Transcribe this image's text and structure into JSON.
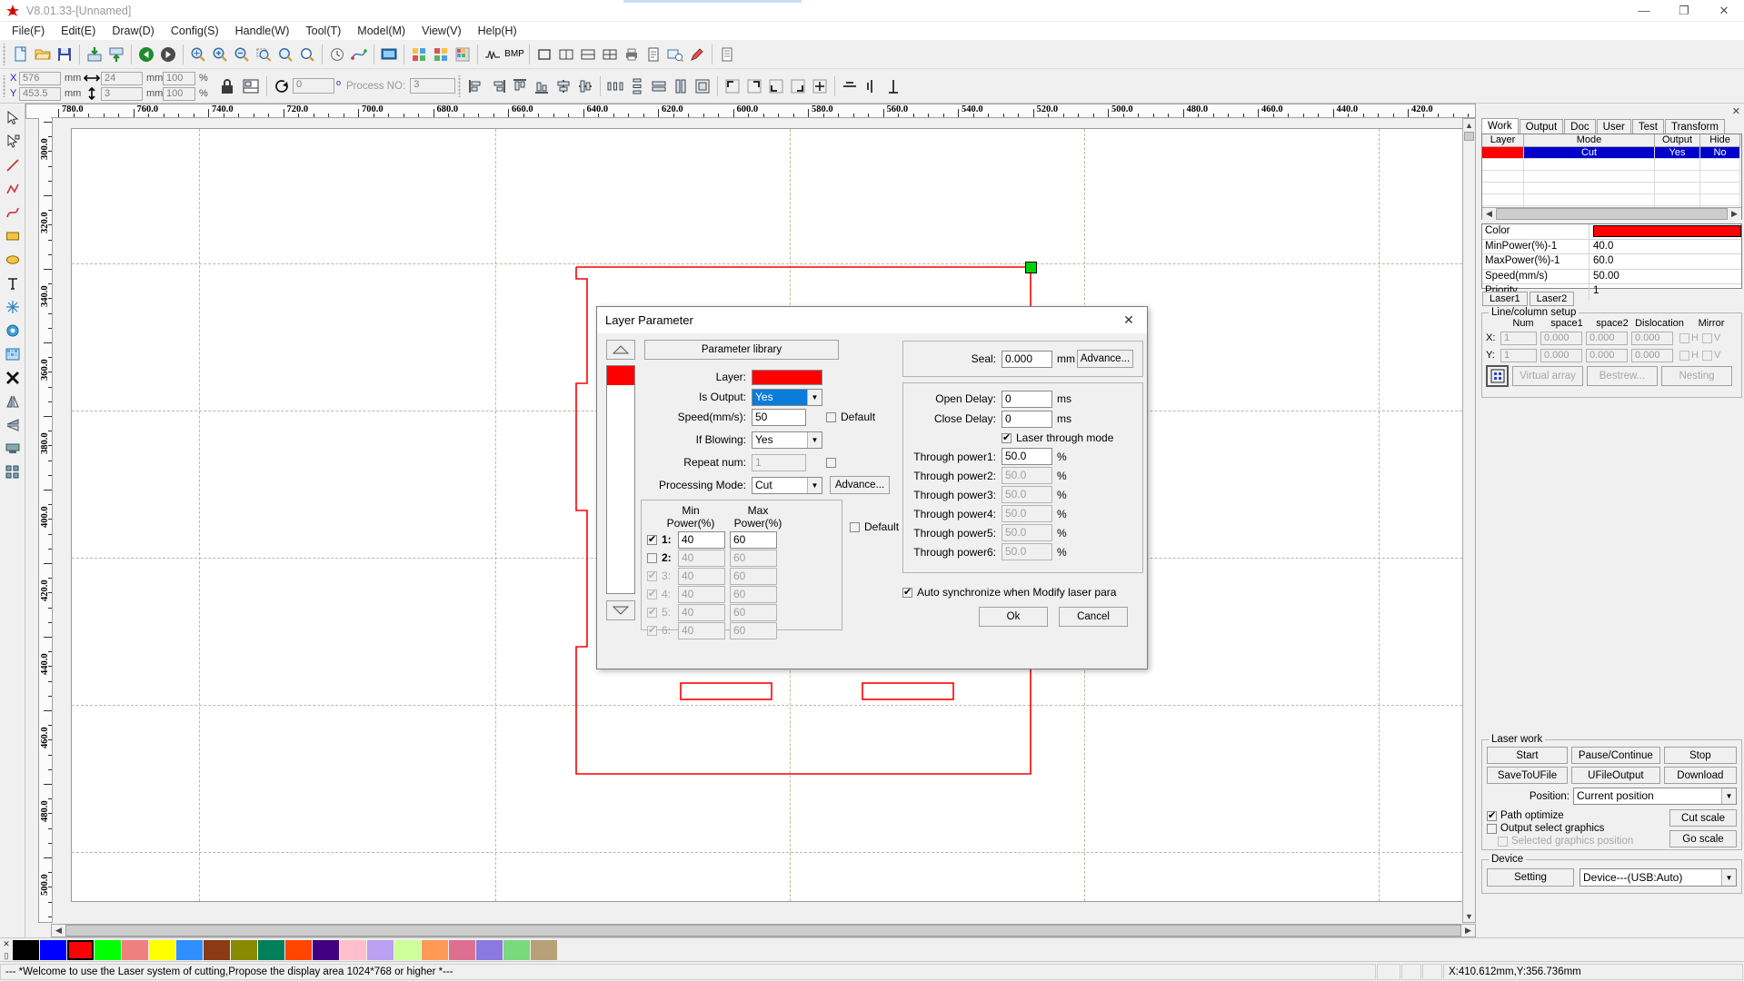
{
  "titlebar": {
    "title": "V8.01.33-[Unnamed]",
    "minimize": "—",
    "maximize": "❐",
    "close": "✕"
  },
  "menubar": {
    "items": [
      "File(F)",
      "Edit(E)",
      "Draw(D)",
      "Config(S)",
      "Handle(W)",
      "Tool(T)",
      "Model(M)",
      "View(V)",
      "Help(H)"
    ]
  },
  "toolbar2": {
    "x_label": "X",
    "x_value": "576",
    "x_unit": "mm",
    "y_label": "Y",
    "y_value": "453.5",
    "y_unit": "mm",
    "w_value": "24",
    "w_unit": "mm",
    "h_value": "3",
    "h_unit": "mm",
    "scale_x": "100",
    "scale_y": "100",
    "percent": "%",
    "angle_value": "0",
    "angle_unit": "o",
    "process_no_label": "Process NO:",
    "process_no_value": "3"
  },
  "rulers": {
    "horizontal": [
      "780.0",
      "760.0",
      "740.0",
      "720.0",
      "700.0",
      "680.0",
      "660.0",
      "640.0",
      "620.0",
      "600.0",
      "580.0",
      "560.0",
      "540.0",
      "520.0",
      "500.0",
      "480.0",
      "460.0",
      "440.0",
      "420.0"
    ],
    "vertical": [
      "300.0",
      "320.0",
      "340.0",
      "360.0",
      "380.0",
      "400.0",
      "420.0",
      "440.0",
      "460.0",
      "480.0",
      "500.0"
    ]
  },
  "right_panel": {
    "close": "✕",
    "tabs": [
      {
        "label": "Work",
        "active": true
      },
      {
        "label": "Output",
        "active": false
      },
      {
        "label": "Doc",
        "active": false
      },
      {
        "label": "User",
        "active": false
      },
      {
        "label": "Test",
        "active": false
      },
      {
        "label": "Transform",
        "active": false
      }
    ],
    "layer_table": {
      "headers": [
        "Layer",
        "Mode",
        "Output",
        "Hide"
      ],
      "rows": [
        {
          "layer_color": "#ff0000",
          "mode": "Cut",
          "output": "Yes",
          "hide": "No",
          "selected": true
        }
      ]
    },
    "properties": [
      {
        "key": "Color",
        "value": "",
        "is_color": true,
        "color": "#ff0000"
      },
      {
        "key": "MinPower(%)-1",
        "value": "40.0"
      },
      {
        "key": "MaxPower(%)-1",
        "value": "60.0"
      },
      {
        "key": "Speed(mm/s)",
        "value": "50.00"
      },
      {
        "key": "Priority",
        "value": "1"
      }
    ],
    "laser_tabs": [
      "Laser1",
      "Laser2"
    ],
    "line_column_setup": {
      "title": "Line/column setup",
      "headers": [
        "Num",
        "space1",
        "space2",
        "Dislocation",
        "Mirror"
      ],
      "rows": [
        {
          "axis": "X:",
          "num": "1",
          "space1": "0.000",
          "space2": "0.000",
          "dislocation": "0.000",
          "mirror_h": "H",
          "mirror_v": "V"
        },
        {
          "axis": "Y:",
          "num": "1",
          "space1": "0.000",
          "space2": "0.000",
          "dislocation": "0.000",
          "mirror_h": "H",
          "mirror_v": "V"
        }
      ],
      "buttons": [
        "Virtual array",
        "Bestrew...",
        "Nesting"
      ]
    },
    "laser_work": {
      "title": "Laser work",
      "buttons_row1": [
        "Start",
        "Pause/Continue",
        "Stop"
      ],
      "buttons_row2": [
        "SaveToUFile",
        "UFileOutput",
        "Download"
      ],
      "position_label": "Position:",
      "position_value": "Current position",
      "path_optimize": {
        "label": "Path optimize",
        "checked": true
      },
      "output_select_graphics": {
        "label": "Output select graphics",
        "checked": false
      },
      "selected_graphics_position": {
        "label": "Selected graphics position",
        "checked": false,
        "disabled": true
      },
      "cut_scale": "Cut scale",
      "go_scale": "Go scale"
    },
    "device": {
      "title": "Device",
      "setting_button": "Setting",
      "device_value": "Device---(USB:Auto)"
    }
  },
  "dialog": {
    "title": "Layer Parameter",
    "close": "✕",
    "parameter_library": "Parameter library",
    "left": {
      "layer_label": "Layer:",
      "layer_color": "#ff0000",
      "is_output_label": "Is Output:",
      "is_output_value": "Yes",
      "speed_label": "Speed(mm/s):",
      "speed_value": "50",
      "speed_default_label": "Default",
      "speed_default_checked": false,
      "if_blowing_label": "If Blowing:",
      "if_blowing_value": "Yes",
      "repeat_num_label": "Repeat num:",
      "repeat_num_value": "1",
      "repeat_num_checked": false,
      "processing_mode_label": "Processing Mode:",
      "processing_mode_value": "Cut",
      "advance_button": "Advance...",
      "power_table": {
        "min_header": "Min Power(%)",
        "max_header": "Max Power(%)",
        "default_label": "Default",
        "default_checked": false,
        "rows": [
          {
            "index": "1:",
            "min": "40",
            "max": "60",
            "checked": true,
            "disabled": false
          },
          {
            "index": "2:",
            "min": "40",
            "max": "60",
            "checked": false,
            "disabled": true
          },
          {
            "index": "3:",
            "min": "40",
            "max": "60",
            "checked": true,
            "disabled": true
          },
          {
            "index": "4:",
            "min": "40",
            "max": "60",
            "checked": true,
            "disabled": true
          },
          {
            "index": "5:",
            "min": "40",
            "max": "60",
            "checked": true,
            "disabled": true
          },
          {
            "index": "6:",
            "min": "40",
            "max": "60",
            "checked": true,
            "disabled": true
          }
        ]
      }
    },
    "right": {
      "seal_label": "Seal:",
      "seal_value": "0.000",
      "seal_unit": "mm",
      "seal_advance_button": "Advance...",
      "open_delay_label": "Open Delay:",
      "open_delay_value": "0",
      "open_delay_unit": "ms",
      "close_delay_label": "Close Delay:",
      "close_delay_value": "0",
      "close_delay_unit": "ms",
      "laser_through_mode_label": "Laser through mode",
      "laser_through_mode_checked": true,
      "through_rows": [
        {
          "label": "Through power1:",
          "value": "50.0",
          "unit": "%",
          "disabled": false
        },
        {
          "label": "Through power2:",
          "value": "50.0",
          "unit": "%",
          "disabled": true
        },
        {
          "label": "Through power3:",
          "value": "50.0",
          "unit": "%",
          "disabled": true
        },
        {
          "label": "Through power4:",
          "value": "50.0",
          "unit": "%",
          "disabled": true
        },
        {
          "label": "Through power5:",
          "value": "50.0",
          "unit": "%",
          "disabled": true
        },
        {
          "label": "Through power6:",
          "value": "50.0",
          "unit": "%",
          "disabled": true
        }
      ]
    },
    "auto_sync_label": "Auto synchronize when Modify laser para",
    "auto_sync_checked": true,
    "ok_button": "Ok",
    "cancel_button": "Cancel"
  },
  "palette": {
    "colors": [
      "#000000",
      "#0000ff",
      "#ff0000",
      "#00ff00",
      "#f08080",
      "#ffff00",
      "#2f8fff",
      "#8b3a14",
      "#8a8a00",
      "#00805a",
      "#ff4500",
      "#400080",
      "#ffc0cb",
      "#b9a0f0",
      "#ccff99",
      "#ff9955",
      "#dd6f91",
      "#8a79e0",
      "#79d97d",
      "#b8a078"
    ],
    "selected_index": 2
  },
  "statusbar": {
    "message": "--- *Welcome to use the Laser system of cutting,Propose the display area 1024*768 or higher *---",
    "coords": "X:410.612mm,Y:356.736mm"
  }
}
